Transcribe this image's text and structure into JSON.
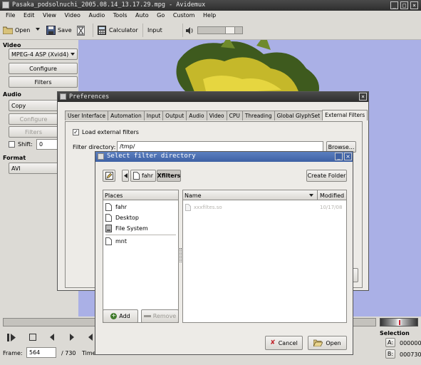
{
  "app": {
    "title": "Pasaka_podsolnuchi_2005.08.14_13.17.29.mpg - Avidemux",
    "menu": [
      "File",
      "Edit",
      "View",
      "Video",
      "Audio",
      "Tools",
      "Auto",
      "Go",
      "Custom",
      "Help"
    ],
    "toolbar": {
      "open": "Open",
      "save": "Save",
      "calculator": "Calculator",
      "input": "Input"
    }
  },
  "left_panel": {
    "video_heading": "Video",
    "video_codec": "MPEG-4 ASP (Xvid4)",
    "configure": "Configure",
    "filters": "Filters",
    "audio_heading": "Audio",
    "audio_codec": "Copy",
    "audio_configure": "Configure",
    "audio_filters": "Filters",
    "shift_label": "Shift:",
    "shift_value": "0",
    "format_heading": "Format",
    "format_value": "AVI"
  },
  "bottom": {
    "frame_label": "Frame:",
    "frame_value": "564",
    "total_frames": "/ 730",
    "time_label": "Time",
    "selection_heading": "Selection",
    "sel_a_label": "A:",
    "sel_a_value": "000000",
    "sel_b_label": "B:",
    "sel_b_value": "000730"
  },
  "preferences": {
    "title": "Preferences",
    "tabs": [
      "User Interface",
      "Automation",
      "Input",
      "Output",
      "Audio",
      "Video",
      "CPU",
      "Threading",
      "Global GlyphSet",
      "External Filters"
    ],
    "load_external": "Load external filters",
    "filter_dir_label": "Filter directory:",
    "filter_dir_value": "/tmp/",
    "browse": "Browse..."
  },
  "file_dialog": {
    "title": "Select filter directory",
    "crumbs": [
      "fahr",
      "Xfilters"
    ],
    "create_folder": "Create Folder",
    "places_header": "Places",
    "places": [
      "fahr",
      "Desktop",
      "File System",
      "mnt"
    ],
    "name_header": "Name",
    "modified_header": "Modified",
    "files": [
      {
        "name": "xxxfiltes.so",
        "modified": "10/17/08"
      }
    ],
    "add": "Add",
    "remove": "Remove",
    "cancel": "Cancel",
    "ok": "Open"
  },
  "colors": {
    "preview_bg": "#aab0e6",
    "accent": "#4a6ea9"
  }
}
